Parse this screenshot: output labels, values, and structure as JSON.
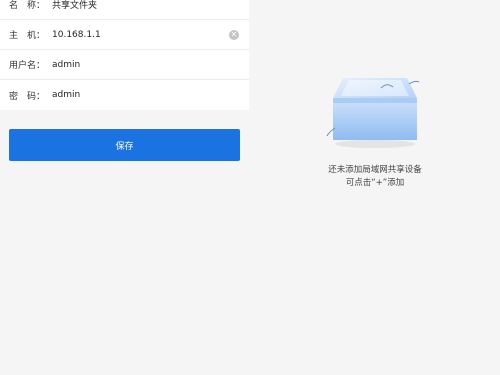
{
  "form": {
    "rows": [
      {
        "label": "名　称：",
        "value": "共享文件夹"
      },
      {
        "label": "主　机：",
        "value": "10.168.1.1"
      },
      {
        "label": "用户名：",
        "value": "admin"
      },
      {
        "label": "密　码：",
        "value": "admin"
      }
    ]
  },
  "save_label": "保存",
  "empty_state": {
    "line1": "还未添加局域网共享设备",
    "line2": "可点击“+”添加"
  },
  "icons": {
    "clear": "clear-circle-icon",
    "empty": "empty-box-icon"
  },
  "colors": {
    "accent": "#1a73e0",
    "background": "#f5f5f5"
  }
}
